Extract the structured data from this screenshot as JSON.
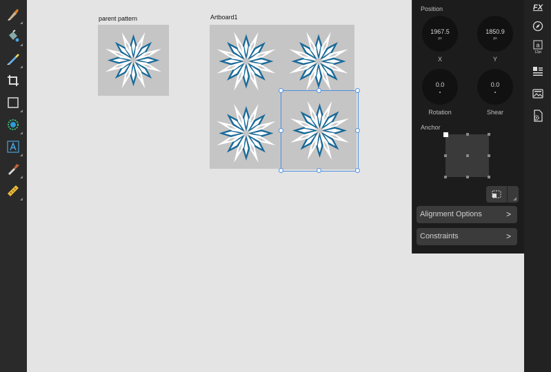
{
  "canvas": {
    "labels": {
      "parent_pattern": "parent pattern",
      "artboard": "Artboard1"
    }
  },
  "left_toolbar": {
    "tools": [
      "brush-icon",
      "fill-icon",
      "paint-brush-icon",
      "crop-icon",
      "rectangle-icon",
      "color-picker-icon",
      "text-frame-icon",
      "eyedropper-icon",
      "ruler-icon"
    ]
  },
  "studio_icons": [
    "fx-icon",
    "compass-icon",
    "text-style-icon",
    "layers-icon",
    "stock-icon",
    "document-icon"
  ],
  "studio": {
    "fx_label": "FX",
    "text_style_size": "12pt"
  },
  "transform_panel": {
    "position_title": "Position",
    "x": {
      "value": "1967.5",
      "unit": "px",
      "label": "X"
    },
    "y": {
      "value": "1850.9",
      "unit": "px",
      "label": "Y"
    },
    "rotation": {
      "value": "0.0",
      "label": "Rotation"
    },
    "shear": {
      "value": "0.0",
      "label": "Shear"
    },
    "anchor_title": "Anchor",
    "alignment_options": "Alignment Options",
    "constraints": "Constraints",
    "chevron": ">"
  },
  "colors": {
    "pattern_blue": "#1a6a99",
    "tile_gray": "#c5c5c5",
    "selection": "#4a90e2"
  }
}
